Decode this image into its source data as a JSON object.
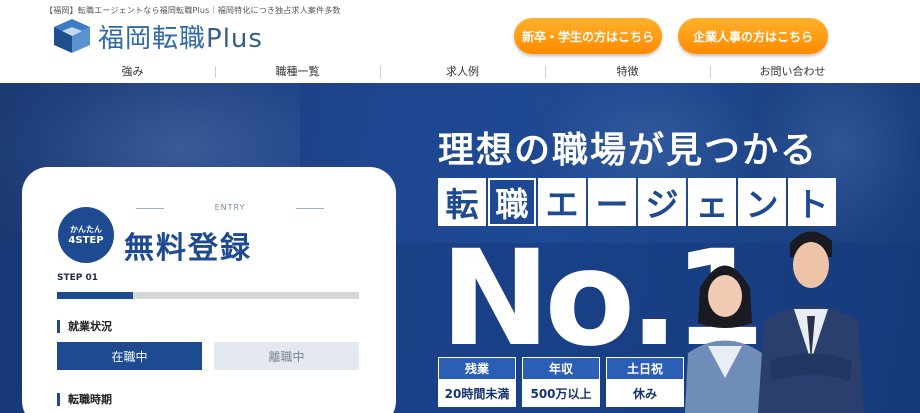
{
  "header": {
    "tagline": "【福岡】転職エージェントなら福岡転職Plus｜福岡特化につき独占求人案件多数",
    "logo_main": "福岡転職",
    "logo_plus": "Plus",
    "cta_students": "新卒・学生の方はこちら",
    "cta_hr": "企業人事の方はこちら",
    "nav": [
      "強み",
      "職種一覧",
      "求人例",
      "特徴",
      "お問い合わせ"
    ]
  },
  "hero": {
    "headline": "理想の職場が見つかる",
    "agent_chars": [
      "転",
      "職",
      "エ",
      "ー",
      "ジ",
      "ェ",
      "ン",
      "ト"
    ],
    "no1": "No.1",
    "badges": [
      {
        "top": "残業",
        "bottom": "20時間未満"
      },
      {
        "top": "年収",
        "bottom": "500万以上"
      },
      {
        "top": "土日祝",
        "bottom": "休み"
      }
    ]
  },
  "form": {
    "entry_label": "ENTRY",
    "circle_line1": "かんたん",
    "circle_line2": "4STEP",
    "title": "無料登録",
    "step_label": "STEP 01",
    "progress": 0.25,
    "employment_label": "就業状況",
    "option_employed": "在職中",
    "option_unemployed": "離職中",
    "timing_label": "転職時期"
  },
  "colors": {
    "brand_blue": "#1e4a92",
    "cta_orange": "#ff9a10",
    "logo_blue": "#2f6aa6"
  }
}
